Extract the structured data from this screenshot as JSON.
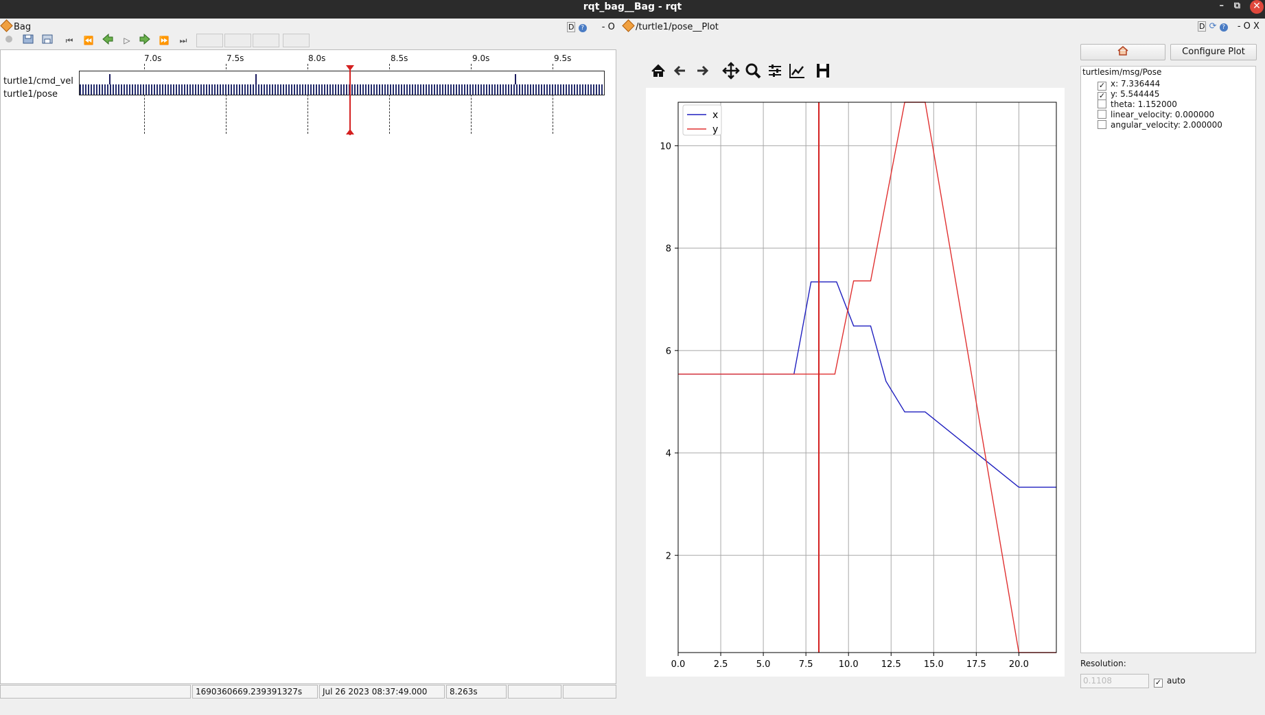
{
  "window": {
    "title": "rqt_bag__Bag - rqt",
    "min": "–",
    "max": "⧉",
    "close": "✕"
  },
  "bag": {
    "header_label": "Bag",
    "ticks": [
      "7.0s",
      "7.5s",
      "8.0s",
      "8.5s",
      "9.0s",
      "9.5s"
    ],
    "topics": [
      "turtle1/cmd_vel",
      "turtle1/pose"
    ],
    "status": [
      "",
      "1690360669.239391327s",
      "Jul 26 2023 08:37:49.000",
      "8.263s",
      "",
      ""
    ]
  },
  "plot": {
    "dock_left_icons": "D",
    "dock_controls": "- O",
    "header_label": "/turtle1/pose__Plot",
    "right_dock_controls": "- O X"
  },
  "chart_data": {
    "type": "line",
    "xlim": [
      0,
      22.2
    ],
    "ylim": [
      0.1,
      10.85
    ],
    "xticks": [
      "0.0",
      "2.5",
      "5.0",
      "7.5",
      "10.0",
      "12.5",
      "15.0",
      "17.5",
      "20.0"
    ],
    "yticks": [
      "2",
      "4",
      "6",
      "8",
      "10"
    ],
    "grid": true,
    "legend": "top-left",
    "vline_x": 8.26,
    "series": [
      {
        "name": "x",
        "color": "#1f1fbf",
        "x": [
          0,
          6.8,
          7.8,
          9.3,
          10.3,
          11.3,
          12.2,
          13.3,
          14.5,
          20.0,
          22.2
        ],
        "y": [
          5.54,
          5.54,
          7.34,
          7.34,
          6.48,
          6.48,
          5.4,
          4.8,
          4.8,
          3.33,
          3.33
        ]
      },
      {
        "name": "y",
        "color": "#e03030",
        "x": [
          0,
          9.2,
          10.3,
          11.3,
          13.3,
          14.5,
          20.0,
          22.2
        ],
        "y": [
          5.54,
          5.54,
          7.36,
          7.36,
          10.85,
          10.85,
          0.1,
          0.1
        ]
      }
    ]
  },
  "config": {
    "home_icon": "home-icon",
    "configure_label": "Configure Plot",
    "tree_root": "turtlesim/msg/Pose",
    "fields": [
      {
        "label": "x:  7.336444",
        "checked": "✓"
      },
      {
        "label": "y:  5.544445",
        "checked": "✓"
      },
      {
        "label": "theta:  1.152000",
        "checked": ""
      },
      {
        "label": "linear_velocity:  0.000000",
        "checked": ""
      },
      {
        "label": "angular_velocity:  2.000000",
        "checked": ""
      }
    ],
    "resolution_label": "Resolution:",
    "resolution_value": "0.1108",
    "auto_label": "auto",
    "auto_checked": "✓"
  }
}
